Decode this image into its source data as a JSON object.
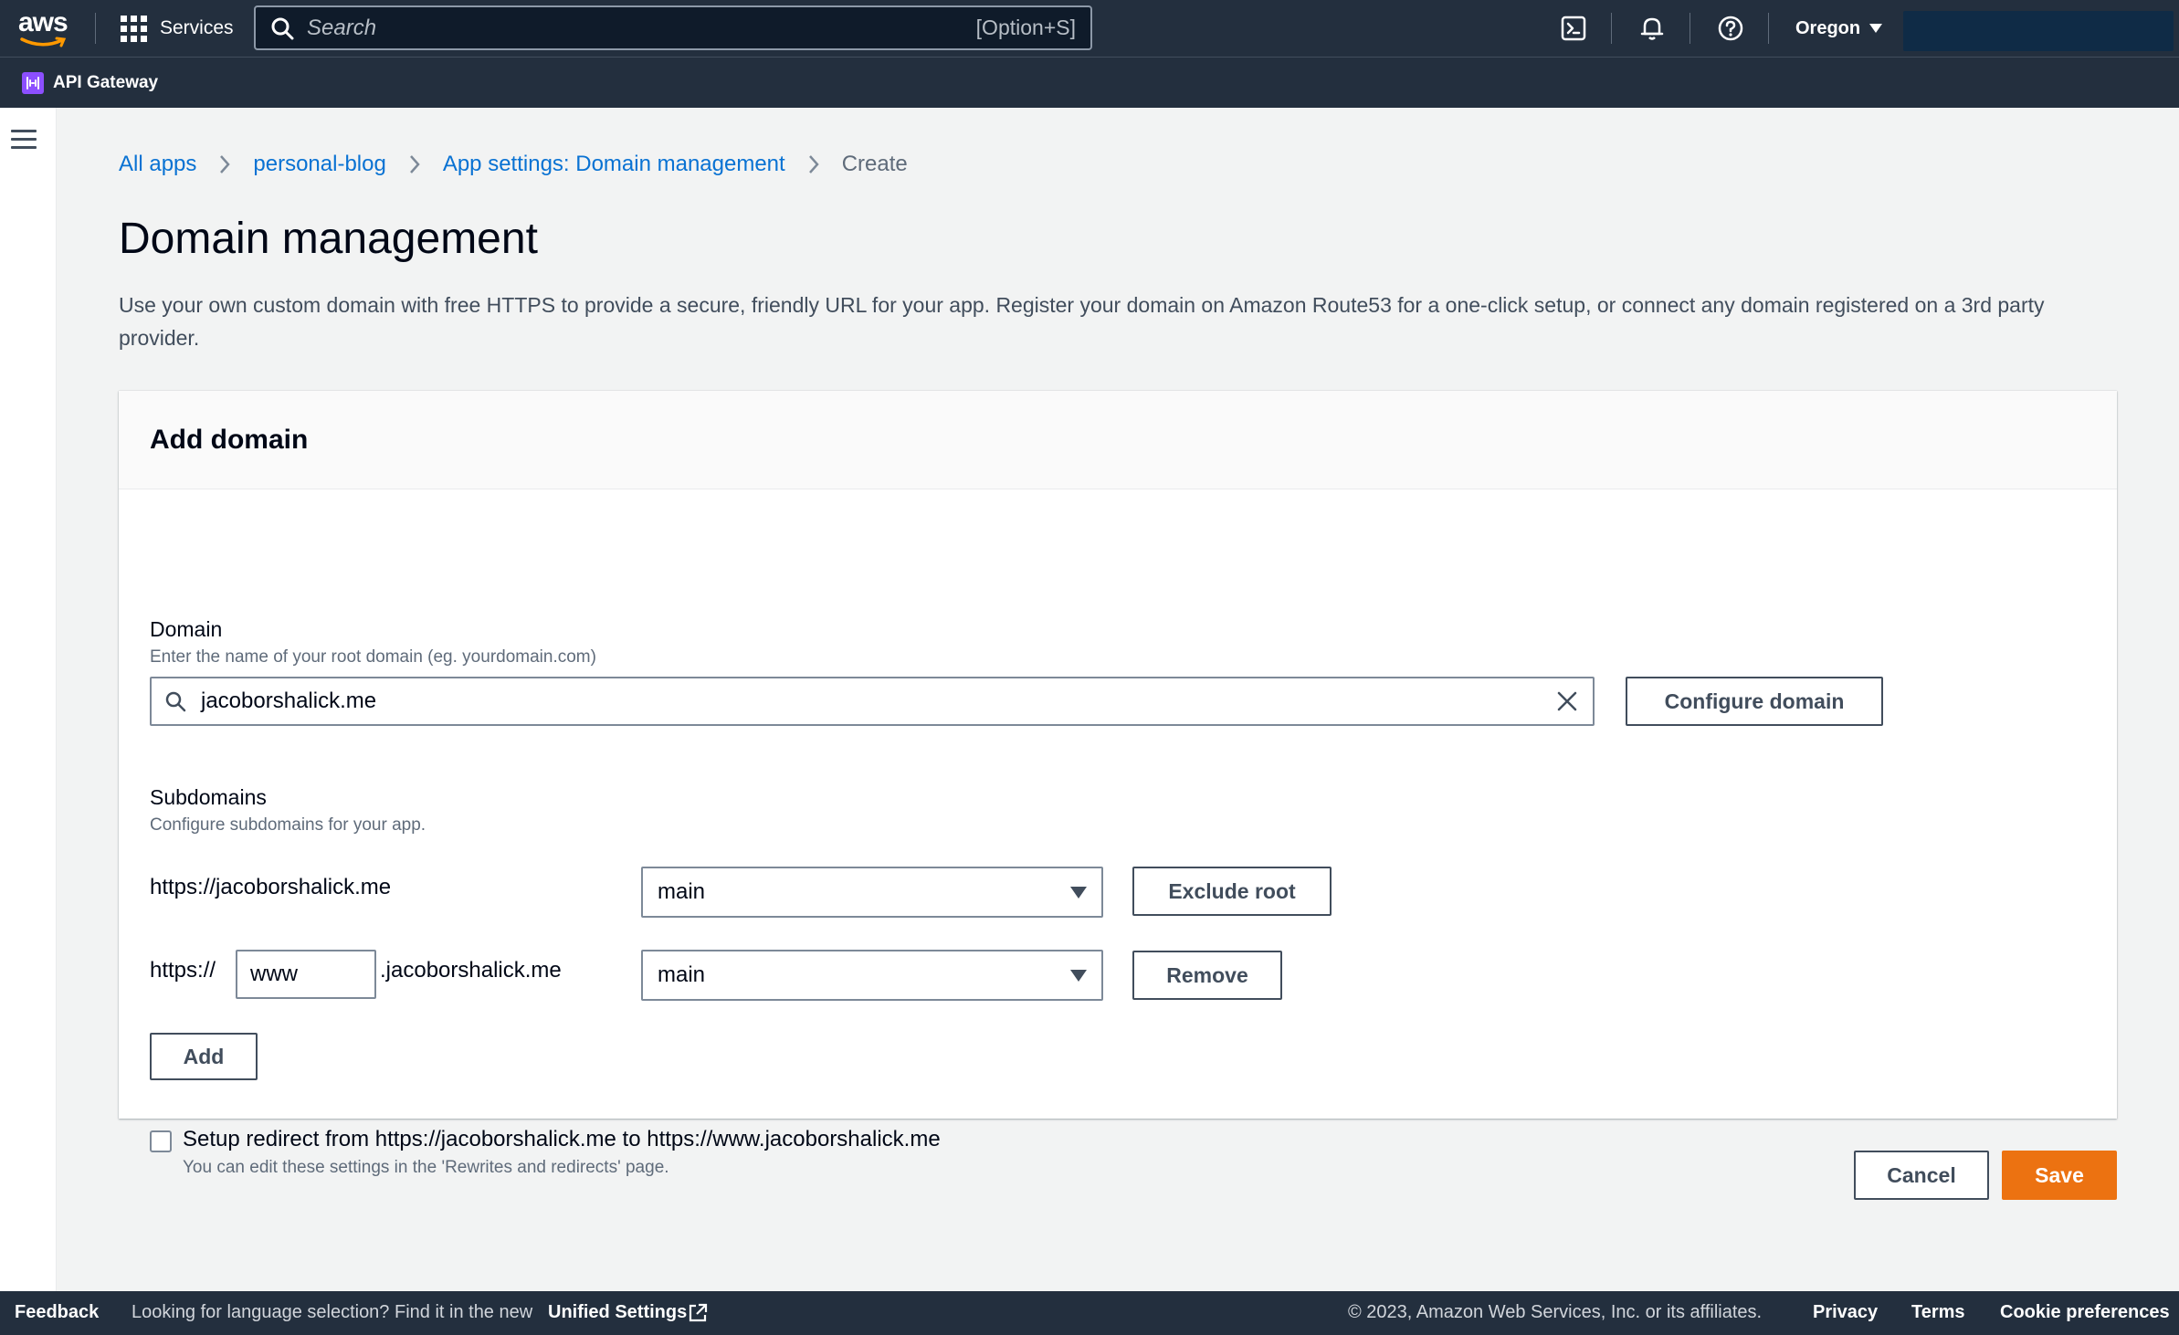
{
  "topnav": {
    "logo_text": "aws",
    "services_label": "Services",
    "search_placeholder": "Search",
    "search_shortcut": "[Option+S]",
    "region": "Oregon",
    "icons": [
      "cloudshell-icon",
      "bell-icon",
      "help-icon"
    ]
  },
  "favorites": {
    "service": "API Gateway"
  },
  "breadcrumb": {
    "items": [
      "All apps",
      "personal-blog",
      "App settings: Domain management"
    ],
    "current": "Create"
  },
  "page": {
    "title": "Domain management",
    "description": "Use your own custom domain with free HTTPS to provide a secure, friendly URL for your app. Register your domain on Amazon Route53 for a one-click setup, or connect any domain registered on a 3rd party provider."
  },
  "panel": {
    "title": "Add domain",
    "domain": {
      "label": "Domain",
      "hint": "Enter the name of your root domain (eg. yourdomain.com)",
      "value": "jacoborshalick.me",
      "configure_label": "Configure domain"
    },
    "subdomains": {
      "label": "Subdomains",
      "hint": "Configure subdomains for your app.",
      "root_url": "https://jacoborshalick.me",
      "root_branch": "main",
      "exclude_label": "Exclude root",
      "prefix_label": "https://",
      "prefix_value": "www",
      "suffix_label": ".jacoborshalick.me",
      "sub_branch": "main",
      "remove_label": "Remove",
      "add_label": "Add"
    },
    "redirect": {
      "label": "Setup redirect from https://jacoborshalick.me to https://www.jacoborshalick.me",
      "hint": "You can edit these settings in the 'Rewrites and redirects' page.",
      "checked": false
    }
  },
  "actions": {
    "cancel": "Cancel",
    "save": "Save"
  },
  "footer": {
    "feedback": "Feedback",
    "lang_prompt": "Looking for language selection? Find it in the new",
    "unified_settings": "Unified Settings",
    "copyright": "© 2023, Amazon Web Services, Inc. or its affiliates.",
    "privacy": "Privacy",
    "terms": "Terms",
    "cookies": "Cookie preferences"
  },
  "colors": {
    "nav": "#232f3e",
    "link": "#0972d3",
    "primary": "#ec7211"
  }
}
